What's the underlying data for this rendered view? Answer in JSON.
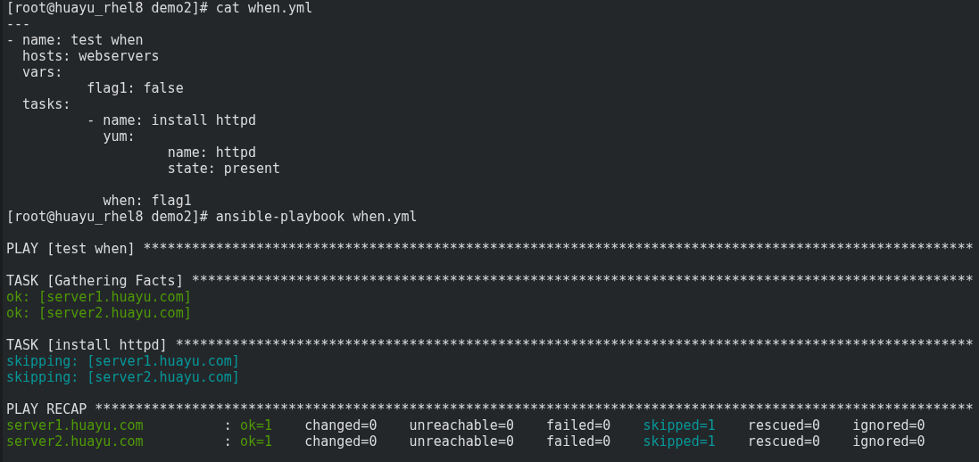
{
  "terminal": {
    "lines": [
      {
        "kind": "text",
        "segments": [
          {
            "kind": "prompt",
            "text": "[root@huayu_rhel8 demo2]# cat when.yml"
          }
        ]
      },
      {
        "kind": "text",
        "segments": [
          {
            "kind": "plain",
            "text": "---"
          }
        ]
      },
      {
        "kind": "text",
        "segments": [
          {
            "kind": "plain",
            "text": "- name: test when"
          }
        ]
      },
      {
        "kind": "text",
        "segments": [
          {
            "kind": "plain",
            "text": "  hosts: webservers"
          }
        ]
      },
      {
        "kind": "text",
        "segments": [
          {
            "kind": "plain",
            "text": "  vars:"
          }
        ]
      },
      {
        "kind": "text",
        "segments": [
          {
            "kind": "plain",
            "text": "          flag1: false"
          }
        ]
      },
      {
        "kind": "text",
        "segments": [
          {
            "kind": "plain",
            "text": "  tasks:"
          }
        ]
      },
      {
        "kind": "text",
        "segments": [
          {
            "kind": "plain",
            "text": "          - name: install httpd"
          }
        ]
      },
      {
        "kind": "text",
        "segments": [
          {
            "kind": "plain",
            "text": "            yum:"
          }
        ]
      },
      {
        "kind": "text",
        "segments": [
          {
            "kind": "plain",
            "text": "                    name: httpd"
          }
        ]
      },
      {
        "kind": "text",
        "segments": [
          {
            "kind": "plain",
            "text": "                    state: present"
          }
        ]
      },
      {
        "kind": "blank"
      },
      {
        "kind": "text",
        "segments": [
          {
            "kind": "plain",
            "text": "            when: flag1"
          }
        ]
      },
      {
        "kind": "text",
        "segments": [
          {
            "kind": "prompt",
            "text": "[root@huayu_rhel8 demo2]# ansible-playbook when.yml"
          }
        ]
      },
      {
        "kind": "blank"
      },
      {
        "kind": "text",
        "segments": [
          {
            "kind": "plain",
            "text": "PLAY [test when] *******************************************************************************************************"
          }
        ]
      },
      {
        "kind": "blank"
      },
      {
        "kind": "text",
        "segments": [
          {
            "kind": "plain",
            "text": "TASK [Gathering Facts] *************************************************************************************************"
          }
        ]
      },
      {
        "kind": "text",
        "segments": [
          {
            "kind": "ok",
            "text": "ok: [server1.huayu.com]"
          }
        ]
      },
      {
        "kind": "text",
        "segments": [
          {
            "kind": "ok",
            "text": "ok: [server2.huayu.com]"
          }
        ]
      },
      {
        "kind": "blank"
      },
      {
        "kind": "text",
        "segments": [
          {
            "kind": "plain",
            "text": "TASK [install httpd] ***************************************************************************************************"
          }
        ]
      },
      {
        "kind": "text",
        "segments": [
          {
            "kind": "skip",
            "text": "skipping: [server1.huayu.com]"
          }
        ]
      },
      {
        "kind": "text",
        "segments": [
          {
            "kind": "skip",
            "text": "skipping: [server2.huayu.com]"
          }
        ]
      },
      {
        "kind": "blank"
      },
      {
        "kind": "text",
        "segments": [
          {
            "kind": "plain",
            "text": "PLAY RECAP *************************************************************************************************************"
          }
        ]
      },
      {
        "kind": "text",
        "segments": [
          {
            "kind": "ok",
            "text": "server1.huayu.com"
          },
          {
            "kind": "plain",
            "text": "          : "
          },
          {
            "kind": "ok",
            "text": "ok=1"
          },
          {
            "kind": "plain",
            "text": "    changed=0    unreachable=0    failed=0    "
          },
          {
            "kind": "skip",
            "text": "skipped=1"
          },
          {
            "kind": "plain",
            "text": "    rescued=0    ignored=0"
          }
        ]
      },
      {
        "kind": "text",
        "segments": [
          {
            "kind": "ok",
            "text": "server2.huayu.com"
          },
          {
            "kind": "plain",
            "text": "          : "
          },
          {
            "kind": "ok",
            "text": "ok=1"
          },
          {
            "kind": "plain",
            "text": "    changed=0    unreachable=0    failed=0    "
          },
          {
            "kind": "skip",
            "text": "skipped=1"
          },
          {
            "kind": "plain",
            "text": "    rescued=0    ignored=0"
          }
        ]
      }
    ]
  }
}
